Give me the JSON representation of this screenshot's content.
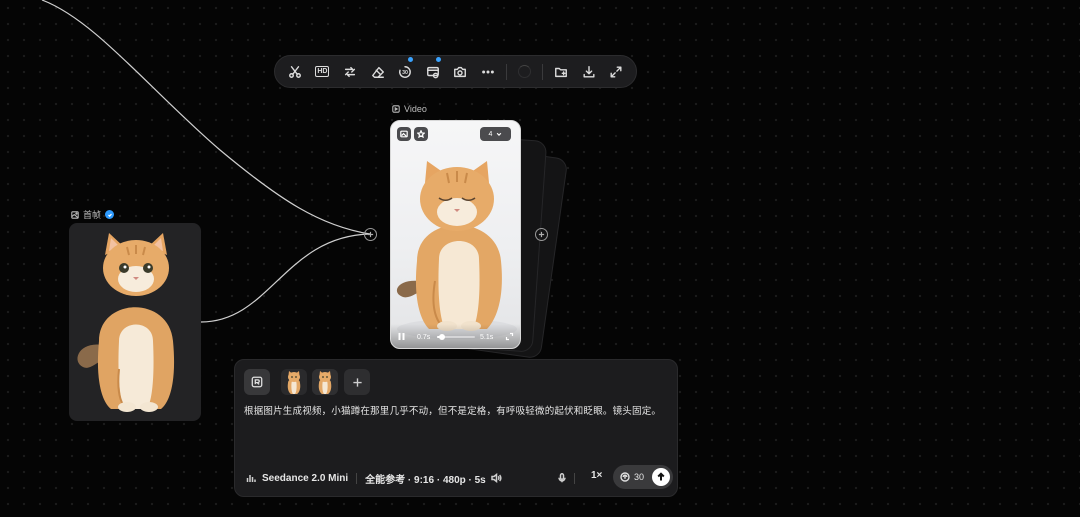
{
  "toolbar": {
    "items": [
      {
        "name": "scissors-icon",
        "badge": false
      },
      {
        "name": "hd-icon",
        "label": "HD",
        "badge": false
      },
      {
        "name": "swap-icon",
        "badge": false
      },
      {
        "name": "eraser-icon",
        "badge": false
      },
      {
        "name": "frame-rate-icon",
        "label": "30",
        "badge": true
      },
      {
        "name": "video-edit-icon",
        "badge": true
      },
      {
        "name": "camera-icon",
        "badge": false
      },
      {
        "name": "more-icon",
        "badge": false
      },
      {
        "name": "loading-icon",
        "badge": false
      },
      {
        "name": "add-folder-icon",
        "badge": false
      },
      {
        "name": "download-icon",
        "badge": false
      },
      {
        "name": "fullscreen-icon",
        "badge": false
      }
    ],
    "badge_color": "#3aa3ff"
  },
  "nodes": {
    "first_frame": {
      "label": "首帧",
      "verified": true
    },
    "video": {
      "label": "Video",
      "count": "4",
      "current_time": "0.7s",
      "duration": "5.1s",
      "progress": 0.14
    }
  },
  "prompt": {
    "text": "根据图片生成视频，小猫蹲在那里几乎不动，但不是定格，有呼吸轻微的起伏和眨眼。镜头固定。",
    "model": "Seedance 2.0 Mini",
    "settings": "全能参考 · 9:16 · 480p · 5s",
    "multiplier": "1×",
    "credits": "30"
  },
  "colors": {
    "accent": "#2e9bff",
    "background": "#050505",
    "panel": "#1c1c1e"
  }
}
